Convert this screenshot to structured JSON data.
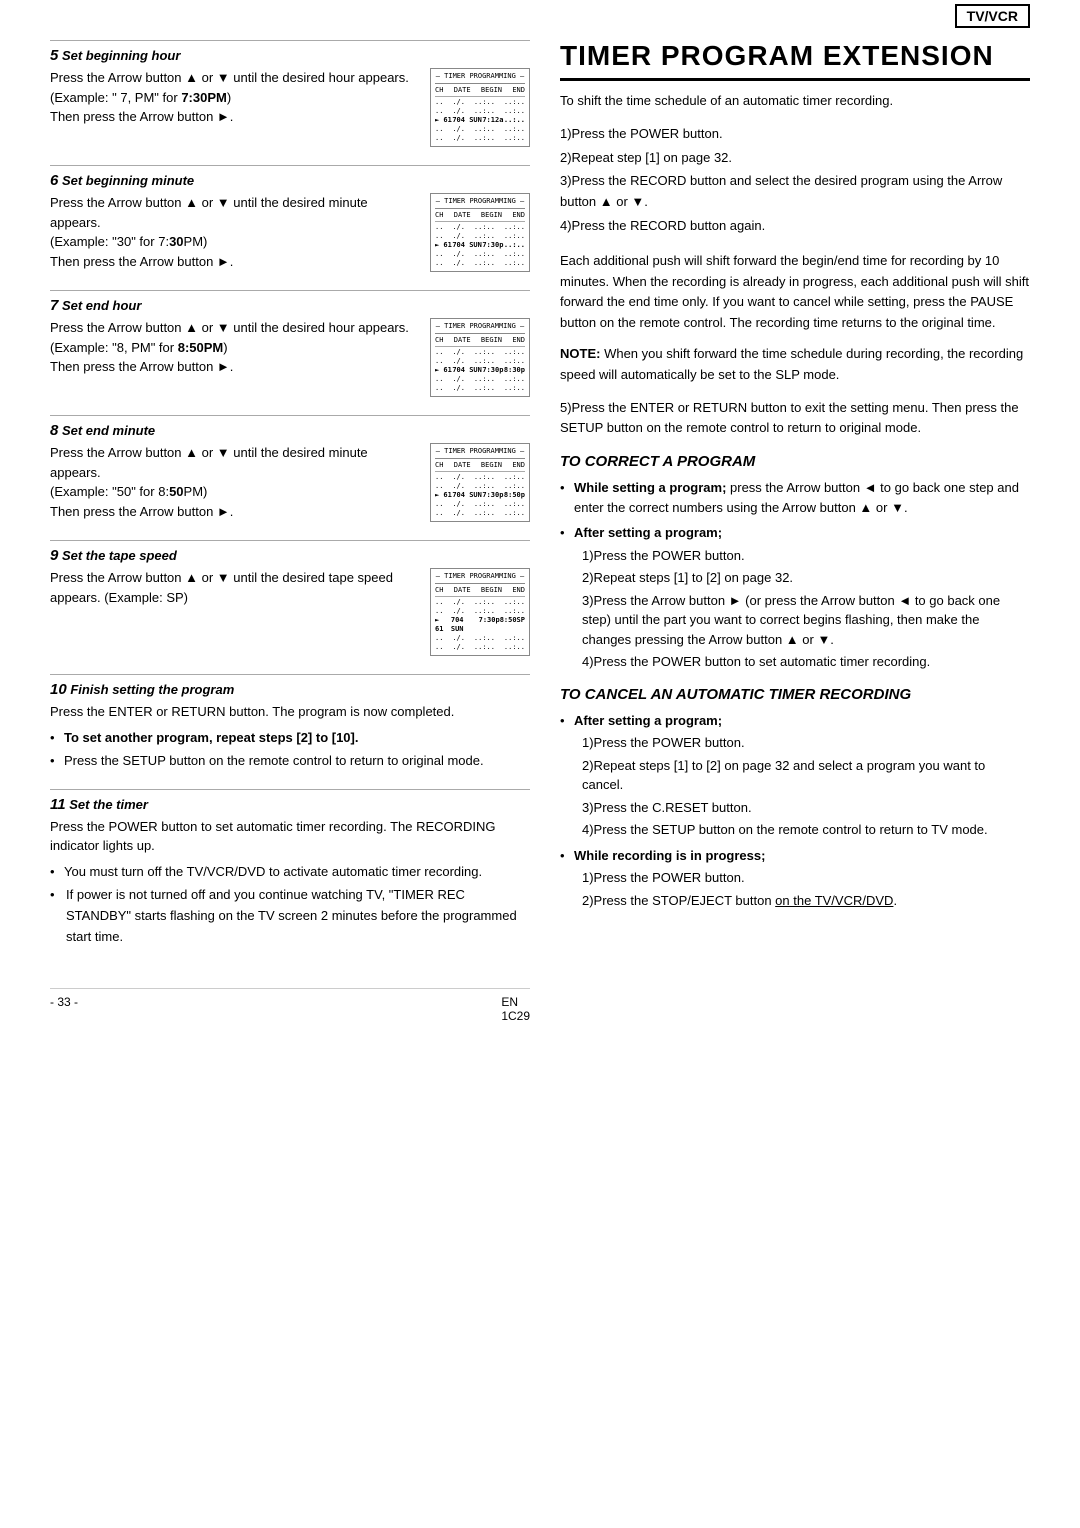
{
  "page": {
    "title": "TIMER PROGRAM EXTENSION",
    "tv_vcr_badge": "TV/VCR",
    "page_number": "- 33 -",
    "page_code": "EN",
    "page_subcode": "1C29"
  },
  "left": {
    "steps": [
      {
        "id": "step5",
        "number": "5",
        "header": "Set beginning hour",
        "text_parts": [
          "Press the Arrow button ▲ or ▼ until the desired hour appears.",
          "(Example: \" 7, PM\" for ",
          "7",
          ":30",
          "PM",
          ")",
          "Then press the Arrow button ►."
        ],
        "text_html": "Press the Arrow button ▲ or ▼ until the desired hour appears.<br>(Example: \" 7, PM\" for <b>7:30PM</b>)<br>Then press the Arrow button ►."
      },
      {
        "id": "step6",
        "number": "6",
        "header": "Set beginning minute",
        "text_html": "Press the Arrow button ▲ or ▼ until the desired minute appears.<br>(Example: \"30\" for 7:<b>30</b>PM)<br>Then press the Arrow button ►."
      },
      {
        "id": "step7",
        "number": "7",
        "header": "Set end hour",
        "text_html": "Press the Arrow button ▲ or ▼ until the desired hour appears.<br>(Example: \"8, PM\" for <b>8:50PM</b>)<br>Then press the Arrow button ►."
      },
      {
        "id": "step8",
        "number": "8",
        "header": "Set end minute",
        "text_html": "Press the Arrow button ▲ or ▼ until the desired minute appears.<br>(Example: \"50\" for 8:<b>50</b>PM)<br>Then press the Arrow button ►."
      },
      {
        "id": "step9",
        "number": "9",
        "header": "Set the tape speed",
        "text_html": "Press the Arrow button ▲ or ▼ until the desired tape speed appears. (Example: SP)"
      }
    ],
    "step10": {
      "number": "10",
      "header": "Finish setting the program",
      "text": "Press the ENTER or RETURN button. The program is now completed.",
      "bullets": [
        "To set another program, repeat steps [2] to [10].",
        "Press the SETUP button on the remote control to return to original mode."
      ]
    },
    "step11": {
      "number": "11",
      "header": "Set the timer",
      "text": "Press the POWER button to set automatic timer recording. The RECORDING indicator lights up.",
      "bullets": [
        "You must turn off the TV/VCR/DVD to activate automatic timer recording.",
        "If power is not turned off and you continue watching TV, \"TIMER REC STANDBY\" starts flashing on the TV screen 2 minutes before the programmed start time."
      ]
    }
  },
  "right": {
    "intro": "To shift the time schedule of an automatic timer recording.",
    "steps": [
      "1)Press the POWER button.",
      "2)Repeat step [1] on page 32.",
      "3)Press the RECORD button and select the desired program using the Arrow button ▲ or ▼.",
      "4)Press the RECORD button again."
    ],
    "body_text": "Each additional push will shift forward the begin/end time for recording by 10 minutes. When the recording is already in progress, each additional push will shift forward the end time only. If you want to cancel while setting, press the PAUSE button on the remote control. The recording time returns to the original time.",
    "note": "NOTE: When you shift forward the time schedule during recording, the recording speed will automatically be set to the SLP mode.",
    "step5": "5)Press the ENTER or RETURN button to exit the setting menu. Then press the SETUP button on the remote control to return to original mode.",
    "to_correct": {
      "heading": "TO CORRECT A PROGRAM",
      "bullets": [
        {
          "label": "While setting a program;",
          "text": " press the Arrow button ◄ to go back one step and enter the correct numbers using the Arrow button ▲ or ▼."
        },
        {
          "label": "After setting a program;",
          "sub_steps": [
            "1)Press the POWER button.",
            "2)Repeat steps [1] to [2] on page 32.",
            "3)Press the Arrow button ► (or press the Arrow button ◄ to go back one step) until the part you want to correct begins flashing, then make the changes pressing the Arrow button ▲ or ▼.",
            "4)Press the POWER button to set automatic timer recording."
          ]
        }
      ]
    },
    "to_cancel": {
      "heading": "TO CANCEL AN AUTOMATIC TIMER RECORDING",
      "bullets": [
        {
          "label": "After setting a program;",
          "sub_steps": [
            "1)Press the POWER button.",
            "2)Repeat steps [1] to [2] on page 32 and select a program you want to cancel.",
            "3)Press the C.RESET button.",
            "4)Press the SETUP button on the remote control to return to TV mode."
          ]
        },
        {
          "label": "While recording is in progress;",
          "sub_steps": [
            "1)Press the POWER button.",
            "2)Press the STOP/EJECT button on the TV/VCR/DVD."
          ]
        }
      ]
    }
  },
  "diagrams": {
    "step5": {
      "title": "– TIMER PROGRAMMING –",
      "header": "CH  DATE      BEGIN  END",
      "rows": [
        {
          "text": "..  ./.        ..:.   ..:. ",
          "highlight": false
        },
        {
          "text": "..  ./.        ..:.   ..:. ",
          "highlight": false
        },
        {
          "text": "61  704 SUN  7:12a   ..:.. ",
          "highlight": true,
          "arrow": true
        },
        {
          "text": "..  ./.        ..:.   ..:. ",
          "highlight": false
        },
        {
          "text": "..  ./.        ..:.   ..:. ",
          "highlight": false
        }
      ]
    },
    "step6": {
      "title": "– TIMER PROGRAMMING –",
      "header": "CH  DATE      BEGIN  END",
      "rows": [
        {
          "text": "..  ./.        ..:.   ..:. ",
          "highlight": false
        },
        {
          "text": "..  ./.        ..:.   ..:. ",
          "highlight": false
        },
        {
          "text": "61  704 SUN  7:30p   ..:.. ",
          "highlight": true,
          "arrow": true
        },
        {
          "text": "..  ./.        ..:.   ..:. ",
          "highlight": false
        },
        {
          "text": "..  ./.        ..:.   ..:. ",
          "highlight": false
        }
      ]
    },
    "step7": {
      "title": "– TIMER PROGRAMMING –",
      "header": "CH  DATE      BEGIN  END",
      "rows": [
        {
          "text": "..  ./.        ..:.   ..:. ",
          "highlight": false
        },
        {
          "text": "..  ./.        ..:.   ..:. ",
          "highlight": false
        },
        {
          "text": "61  704 SUN  7:30p  8:30p ",
          "highlight": true,
          "arrow": true
        },
        {
          "text": "..  ./.        ..:.   ..:. ",
          "highlight": false
        },
        {
          "text": "..  ./.        ..:.   ..:. ",
          "highlight": false
        }
      ]
    },
    "step8": {
      "title": "– TIMER PROGRAMMING –",
      "header": "CH  DATE      BEGIN  END",
      "rows": [
        {
          "text": "..  ./.        ..:.   ..:. ",
          "highlight": false
        },
        {
          "text": "..  ./.        ..:.   ..:. ",
          "highlight": false
        },
        {
          "text": "61  704 SUN  7:30p  8:50p ",
          "highlight": true,
          "arrow": true
        },
        {
          "text": "..  ./.        ..:.   ..:. ",
          "highlight": false
        },
        {
          "text": "..  ./.        ..:.   ..:. ",
          "highlight": false
        }
      ]
    },
    "step9": {
      "title": "– TIMER PROGRAMMING –",
      "header": "CH  DATE      BEGIN  END",
      "rows": [
        {
          "text": "..  ./.        ..:.   ..:. ",
          "highlight": false
        },
        {
          "text": "..  ./.        ..:.   ..:. ",
          "highlight": false
        },
        {
          "text": "61  704 SUN  7:30p  8:50SP",
          "highlight": true,
          "arrow": true
        },
        {
          "text": "..  ./.        ..:.   ..:. ",
          "highlight": false
        },
        {
          "text": "..  ./.        ..:.   ..:. ",
          "highlight": false
        }
      ]
    }
  }
}
